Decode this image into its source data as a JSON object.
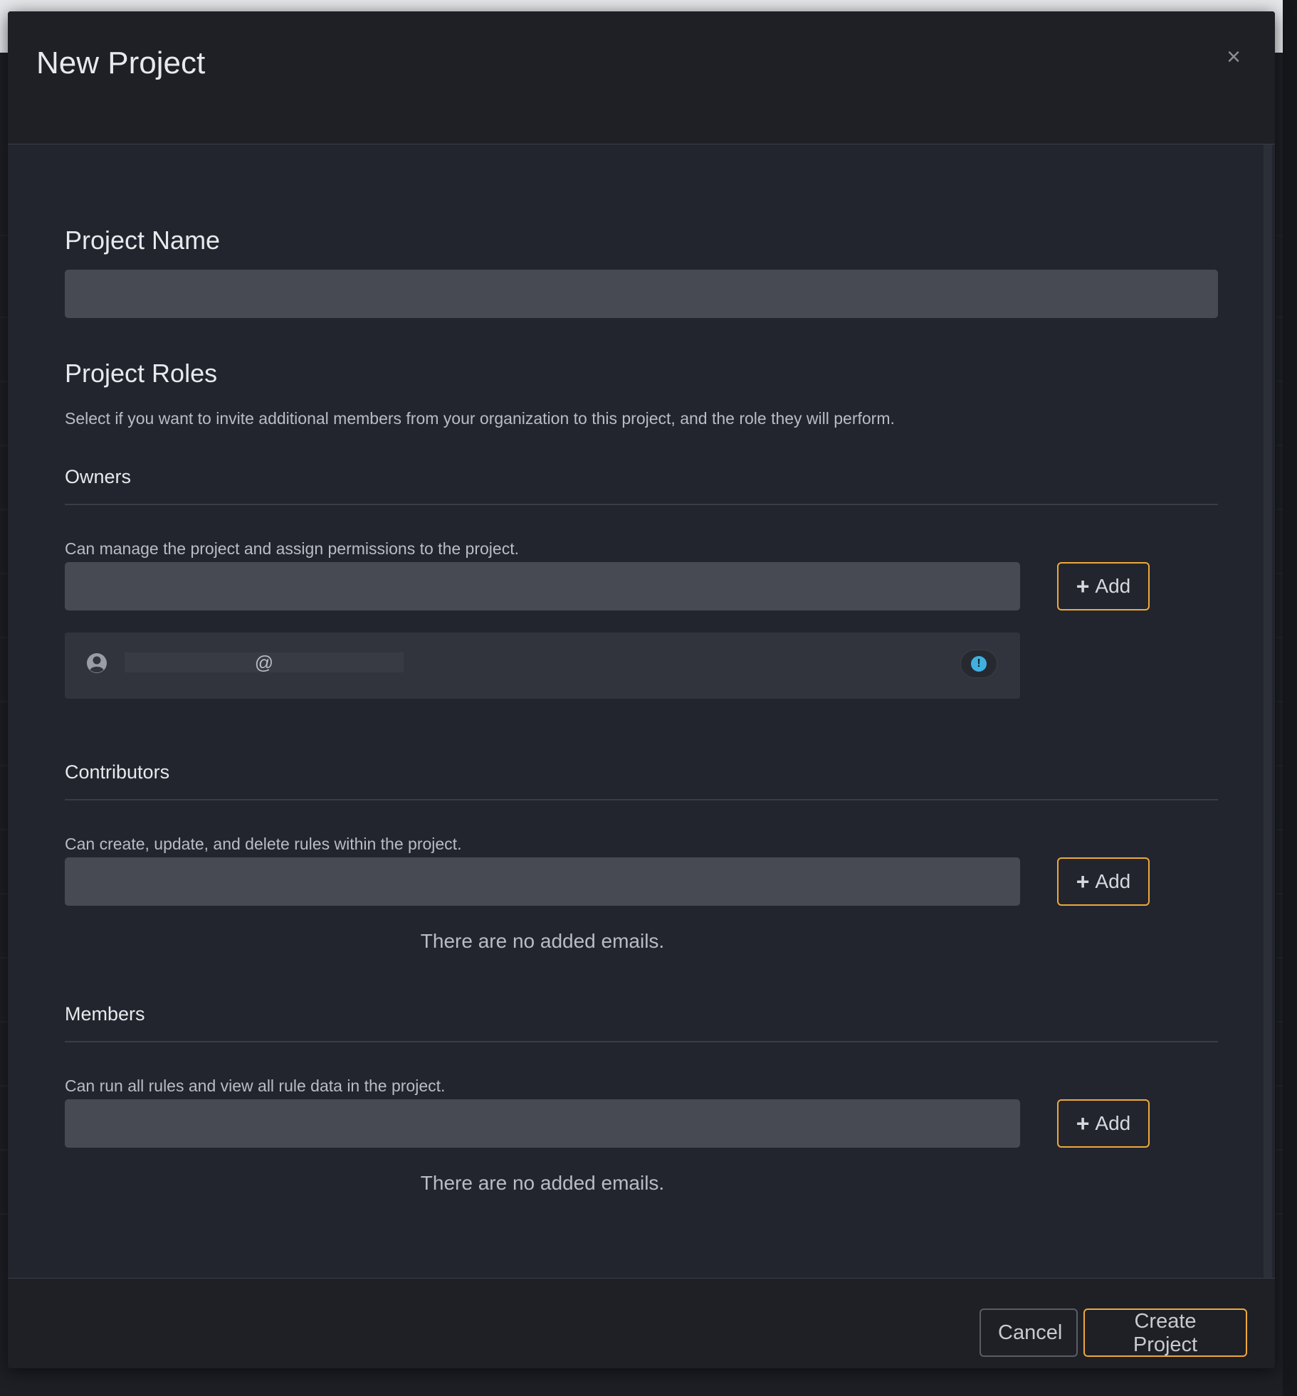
{
  "modal": {
    "title": "New Project",
    "close_glyph": "×"
  },
  "project_name": {
    "label": "Project Name",
    "value": "",
    "placeholder": ""
  },
  "roles": {
    "heading": "Project Roles",
    "description": "Select if you want to invite additional members from your organization to this project, and the role they will perform.",
    "owners": {
      "title": "Owners",
      "help": "Can manage the project and assign permissions to the project.",
      "input_value": "",
      "add_label": "Add",
      "emails": [
        {
          "text": "@",
          "icon": "user-circle-icon",
          "status_icon": "exclamation-circle-icon"
        }
      ]
    },
    "contributors": {
      "title": "Contributors",
      "help": "Can create, update, and delete rules within the project.",
      "input_value": "",
      "add_label": "Add",
      "empty_message": "There are no added emails."
    },
    "members": {
      "title": "Members",
      "help": "Can run all rules and view all rule data in the project.",
      "input_value": "",
      "add_label": "Add",
      "empty_message": "There are no added emails."
    }
  },
  "footer": {
    "cancel_label": "Cancel",
    "create_label": "Create Project"
  },
  "colors": {
    "accent": "#f0a83a",
    "info": "#3fb0e0",
    "modal_bg": "#22252d",
    "input_bg": "#474a52"
  }
}
